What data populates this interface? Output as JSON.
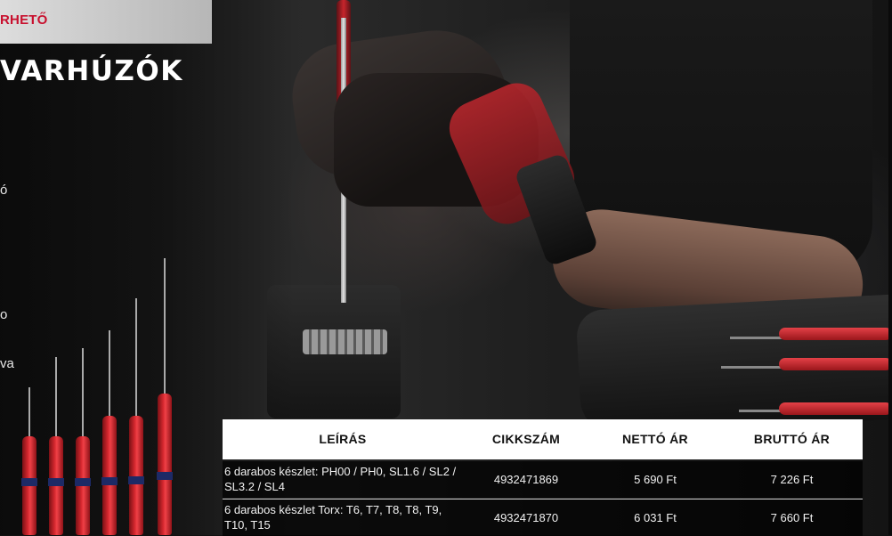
{
  "banner": {
    "text": "RHETŐ"
  },
  "title": "VARHÚZÓK",
  "fragments": {
    "a": "ó",
    "b": "o",
    "c": "va"
  },
  "table": {
    "headers": {
      "description": "LEÍRÁS",
      "sku": "CIKKSZÁM",
      "net": "NETTÓ ÁR",
      "gross": "BRUTTÓ ÁR"
    },
    "rows": [
      {
        "description": "6 darabos készlet: PH00 / PH0, SL1.6 / SL2 / SL3.2 / SL4",
        "sku": "4932471869",
        "net": "5 690 Ft",
        "gross": "7 226 Ft"
      },
      {
        "description": "6 darabos készlet Torx: T6, T7, T8, T8, T9, T10, T15",
        "sku": "4932471870",
        "net": "6 031 Ft",
        "gross": "7 660 Ft"
      }
    ]
  },
  "colors": {
    "accent": "#c8102e",
    "handle_red": "#d6282f",
    "band_blue": "#1d2a66"
  },
  "icons": [
    "screwdriver-icon"
  ]
}
